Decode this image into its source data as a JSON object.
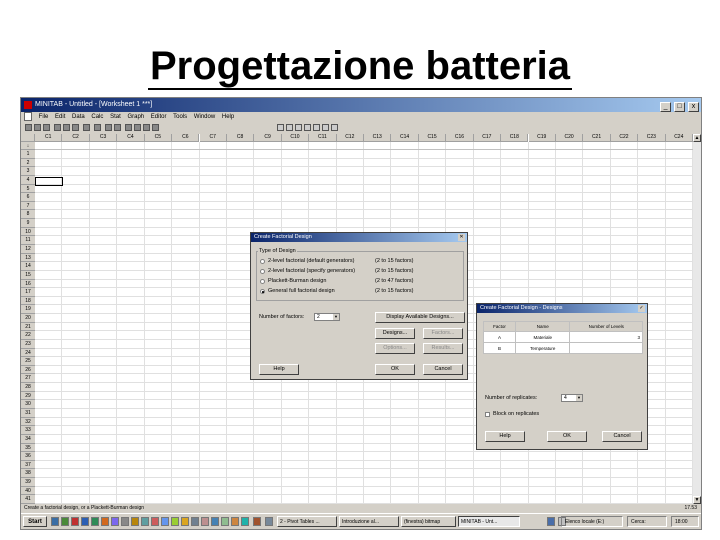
{
  "slide": {
    "title": "Progettazione batteria"
  },
  "window": {
    "title": "MINITAB - Untitled - [Worksheet 1 ***]",
    "min": "_",
    "max": "□",
    "close": "x"
  },
  "menu": [
    "File",
    "Edit",
    "Data",
    "Calc",
    "Stat",
    "Graph",
    "Editor",
    "Tools",
    "Window",
    "Help"
  ],
  "sheet": {
    "columns": [
      "C1",
      "C2",
      "C3",
      "C4",
      "C5",
      "C6",
      "C7",
      "C8",
      "C9",
      "C10",
      "C11",
      "C12",
      "C13",
      "C14",
      "C15",
      "C16",
      "C17",
      "C18",
      "C19",
      "C20",
      "C21",
      "C22",
      "C23",
      "C24"
    ],
    "name_row_marker": "↓",
    "rows": [
      "1",
      "2",
      "3",
      "4",
      "5",
      "6",
      "7",
      "8",
      "9",
      "10",
      "11",
      "12",
      "13",
      "14",
      "15",
      "16",
      "17",
      "18",
      "19",
      "20",
      "21",
      "22",
      "23",
      "24",
      "25",
      "26",
      "27",
      "28",
      "29",
      "30",
      "31",
      "32",
      "33",
      "34",
      "35",
      "36",
      "37",
      "38",
      "39",
      "40",
      "41"
    ]
  },
  "dialog1": {
    "title": "Create Factorial Design",
    "type_label": "Type of Design",
    "options": [
      {
        "label": "2-level factorial (default generators)",
        "range": "(2 to 15 factors)",
        "selected": false
      },
      {
        "label": "2-level factorial (specify generators)",
        "range": "(2 to 15 factors)",
        "selected": false
      },
      {
        "label": "Plackett-Burman design",
        "range": "(2 to 47 factors)",
        "selected": false
      },
      {
        "label": "General full factorial design",
        "range": "(2 to 15 factors)",
        "selected": true
      }
    ],
    "num_factors_label": "Number of factors:",
    "num_factors_value": "2",
    "btn_display": "Display Available Designs...",
    "btn_designs": "Designs...",
    "btn_factors": "Factors...",
    "btn_options": "Options...",
    "btn_results": "Results...",
    "btn_help": "Help",
    "btn_ok": "OK",
    "btn_cancel": "Cancel"
  },
  "dialog2": {
    "title": "Create Factorial Design - Designs",
    "headers": [
      "Factor",
      "Name",
      "Number of Levels"
    ],
    "rows": [
      {
        "factor": "A",
        "name": "Materiale",
        "levels": "3"
      },
      {
        "factor": "B",
        "name": "Temperature",
        "levels": ""
      }
    ],
    "replicates_label": "Number of replicates:",
    "replicates_value": "4",
    "block_label": "Block on replicates",
    "btn_help": "Help",
    "btn_ok": "OK",
    "btn_cancel": "Cancel"
  },
  "status": {
    "text": "Create a factorial design, or a Plackett-Burman design",
    "time": "17.53"
  },
  "taskbar": {
    "start": "Start",
    "tasks": [
      "2 - Pivot Tables ...",
      "Introduzione al...",
      "(finestra) bitmap",
      "MINITAB - Unt..."
    ],
    "tray_text": "Elenco locale (E:)",
    "tray_extra": "Cerca:",
    "time": "18:00"
  },
  "colors": {
    "titlebar": "#0a246a",
    "face": "#d4d0c8"
  }
}
